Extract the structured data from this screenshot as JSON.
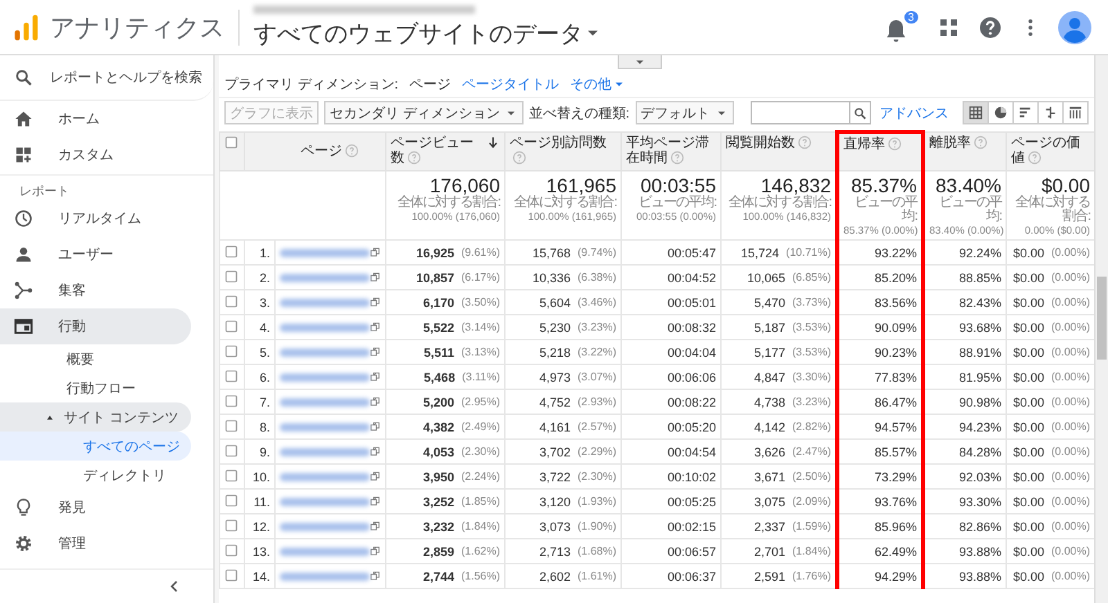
{
  "header": {
    "app_title": "アナリティクス",
    "property_title": "すべてのウェブサイトのデータ",
    "notification_count": "3"
  },
  "sidebar": {
    "search_label": "レポートとヘルプを検索",
    "items": [
      {
        "kind": "link",
        "label": "ホーム",
        "selected": false
      },
      {
        "kind": "link",
        "label": "カスタム",
        "selected": false
      },
      {
        "kind": "section",
        "label": "レポート"
      },
      {
        "kind": "link",
        "label": "リアルタイム",
        "selected": false
      },
      {
        "kind": "link",
        "label": "ユーザー",
        "selected": false
      },
      {
        "kind": "link",
        "label": "集客",
        "selected": false
      },
      {
        "kind": "group",
        "label": "行動",
        "expanded": true,
        "children": [
          {
            "label": "概要",
            "selected": false
          },
          {
            "label": "行動フロー",
            "selected": false
          },
          {
            "label": "サイト コンテンツ",
            "expanded": true,
            "children": [
              {
                "label": "すべてのページ",
                "selected": true
              },
              {
                "label": "ディレクトリ",
                "selected": false
              }
            ]
          }
        ]
      },
      {
        "kind": "link",
        "label": "発見",
        "selected": false
      },
      {
        "kind": "link",
        "label": "管理",
        "selected": false
      }
    ]
  },
  "report": {
    "primary_dimension": {
      "label": "プライマリ ディメンション:",
      "options": [
        {
          "label": "ページ",
          "selected": true,
          "dropdown": false
        },
        {
          "label": "ページタイトル",
          "selected": false,
          "dropdown": false
        },
        {
          "label": "その他",
          "selected": false,
          "dropdown": true
        }
      ]
    },
    "toolbar": {
      "chart_button": {
        "label": "グラフに表示",
        "disabled": true
      },
      "secondary_dimension": "セカンダリ ディメンション",
      "sort_label": "並べ替えの種類:",
      "sort_value": "デフォルト",
      "advanced_link": "アドバンス",
      "views": [
        {
          "selected": true
        },
        {
          "selected": false
        },
        {
          "selected": false
        },
        {
          "selected": false
        },
        {
          "selected": false
        }
      ]
    },
    "table": {
      "columns": [
        {
          "label": "ページ",
          "sorted": false,
          "highlighted": false
        },
        {
          "label": "ページビュー数",
          "sorted": true,
          "highlighted": false
        },
        {
          "label": "ページ別訪問数",
          "sorted": false,
          "highlighted": false
        },
        {
          "label": "平均ページ滞在時間",
          "sorted": false,
          "highlighted": false
        },
        {
          "label": "閲覧開始数",
          "sorted": false,
          "highlighted": false
        },
        {
          "label": "直帰率",
          "sorted": false,
          "highlighted": true
        },
        {
          "label": "離脱率",
          "sorted": false,
          "highlighted": false
        },
        {
          "label": "ページの価値",
          "sorted": false,
          "highlighted": false
        }
      ],
      "totals": [
        {
          "value": "176,060",
          "label": "全体に対する割合:",
          "detail": "100.00% (176,060)"
        },
        {
          "value": "161,965",
          "label": "全体に対する割合:",
          "detail": "100.00% (161,965)"
        },
        {
          "value": "00:03:55",
          "label": "ビューの平均:",
          "detail": "00:03:55 (0.00%)"
        },
        {
          "value": "146,832",
          "label": "全体に対する割合:",
          "detail": "100.00% (146,832)"
        },
        {
          "value": "85.37%",
          "label": "ビューの平均:",
          "detail": "85.37% (0.00%)"
        },
        {
          "value": "83.40%",
          "label": "ビューの平均:",
          "detail": "83.40% (0.00%)"
        },
        {
          "value": "$0.00",
          "label": "全体に対する割合:",
          "detail": "0.00% ($0.00)"
        }
      ],
      "rows": [
        {
          "selected": false,
          "number": "1.",
          "cells": [
            [
              ""
            ],
            [
              "16,925",
              "(9.61%)"
            ],
            [
              "15,768",
              "(9.74%)"
            ],
            [
              "00:05:47"
            ],
            [
              "15,724",
              "(10.71%)"
            ],
            [
              "93.22%"
            ],
            [
              "92.24%"
            ],
            [
              "$0.00",
              "(0.00%)"
            ]
          ]
        },
        {
          "selected": false,
          "number": "2.",
          "cells": [
            [
              ""
            ],
            [
              "10,857",
              "(6.17%)"
            ],
            [
              "10,336",
              "(6.38%)"
            ],
            [
              "00:04:52"
            ],
            [
              "10,065",
              "(6.85%)"
            ],
            [
              "85.20%"
            ],
            [
              "88.85%"
            ],
            [
              "$0.00",
              "(0.00%)"
            ]
          ]
        },
        {
          "selected": false,
          "number": "3.",
          "cells": [
            [
              ""
            ],
            [
              "6,170",
              "(3.50%)"
            ],
            [
              "5,604",
              "(3.46%)"
            ],
            [
              "00:05:01"
            ],
            [
              "5,470",
              "(3.73%)"
            ],
            [
              "83.56%"
            ],
            [
              "82.43%"
            ],
            [
              "$0.00",
              "(0.00%)"
            ]
          ]
        },
        {
          "selected": false,
          "number": "4.",
          "cells": [
            [
              ""
            ],
            [
              "5,522",
              "(3.14%)"
            ],
            [
              "5,230",
              "(3.23%)"
            ],
            [
              "00:08:32"
            ],
            [
              "5,187",
              "(3.53%)"
            ],
            [
              "90.09%"
            ],
            [
              "93.68%"
            ],
            [
              "$0.00",
              "(0.00%)"
            ]
          ]
        },
        {
          "selected": false,
          "number": "5.",
          "cells": [
            [
              ""
            ],
            [
              "5,511",
              "(3.13%)"
            ],
            [
              "5,218",
              "(3.22%)"
            ],
            [
              "00:04:04"
            ],
            [
              "5,177",
              "(3.53%)"
            ],
            [
              "90.23%"
            ],
            [
              "88.91%"
            ],
            [
              "$0.00",
              "(0.00%)"
            ]
          ]
        },
        {
          "selected": false,
          "number": "6.",
          "cells": [
            [
              ""
            ],
            [
              "5,468",
              "(3.11%)"
            ],
            [
              "4,973",
              "(3.07%)"
            ],
            [
              "00:06:06"
            ],
            [
              "4,847",
              "(3.30%)"
            ],
            [
              "77.83%"
            ],
            [
              "81.95%"
            ],
            [
              "$0.00",
              "(0.00%)"
            ]
          ]
        },
        {
          "selected": false,
          "number": "7.",
          "cells": [
            [
              ""
            ],
            [
              "5,200",
              "(2.95%)"
            ],
            [
              "4,752",
              "(2.93%)"
            ],
            [
              "00:08:22"
            ],
            [
              "4,738",
              "(3.23%)"
            ],
            [
              "86.47%"
            ],
            [
              "90.98%"
            ],
            [
              "$0.00",
              "(0.00%)"
            ]
          ]
        },
        {
          "selected": false,
          "number": "8.",
          "cells": [
            [
              ""
            ],
            [
              "4,382",
              "(2.49%)"
            ],
            [
              "4,161",
              "(2.57%)"
            ],
            [
              "00:05:20"
            ],
            [
              "4,142",
              "(2.82%)"
            ],
            [
              "94.57%"
            ],
            [
              "94.23%"
            ],
            [
              "$0.00",
              "(0.00%)"
            ]
          ]
        },
        {
          "selected": false,
          "number": "9.",
          "cells": [
            [
              ""
            ],
            [
              "4,053",
              "(2.30%)"
            ],
            [
              "3,702",
              "(2.29%)"
            ],
            [
              "00:04:54"
            ],
            [
              "3,626",
              "(2.47%)"
            ],
            [
              "85.57%"
            ],
            [
              "84.28%"
            ],
            [
              "$0.00",
              "(0.00%)"
            ]
          ]
        },
        {
          "selected": false,
          "number": "10.",
          "cells": [
            [
              ""
            ],
            [
              "3,950",
              "(2.24%)"
            ],
            [
              "3,722",
              "(2.30%)"
            ],
            [
              "00:10:02"
            ],
            [
              "3,671",
              "(2.50%)"
            ],
            [
              "73.29%"
            ],
            [
              "92.03%"
            ],
            [
              "$0.00",
              "(0.00%)"
            ]
          ]
        },
        {
          "selected": false,
          "number": "11.",
          "cells": [
            [
              ""
            ],
            [
              "3,252",
              "(1.85%)"
            ],
            [
              "3,120",
              "(1.93%)"
            ],
            [
              "00:05:25"
            ],
            [
              "3,075",
              "(2.09%)"
            ],
            [
              "93.76%"
            ],
            [
              "93.30%"
            ],
            [
              "$0.00",
              "(0.00%)"
            ]
          ]
        },
        {
          "selected": false,
          "number": "12.",
          "cells": [
            [
              ""
            ],
            [
              "3,232",
              "(1.84%)"
            ],
            [
              "3,073",
              "(1.90%)"
            ],
            [
              "00:02:15"
            ],
            [
              "2,337",
              "(1.59%)"
            ],
            [
              "85.96%"
            ],
            [
              "82.86%"
            ],
            [
              "$0.00",
              "(0.00%)"
            ]
          ]
        },
        {
          "selected": false,
          "number": "13.",
          "cells": [
            [
              ""
            ],
            [
              "2,859",
              "(1.62%)"
            ],
            [
              "2,713",
              "(1.68%)"
            ],
            [
              "00:06:57"
            ],
            [
              "2,701",
              "(1.84%)"
            ],
            [
              "62.49%"
            ],
            [
              "93.88%"
            ],
            [
              "$0.00",
              "(0.00%)"
            ]
          ]
        },
        {
          "selected": false,
          "number": "14.",
          "cells": [
            [
              ""
            ],
            [
              "2,744",
              "(1.56%)"
            ],
            [
              "2,602",
              "(1.61%)"
            ],
            [
              "00:06:37"
            ],
            [
              "2,591",
              "(1.76%)"
            ],
            [
              "94.29%"
            ],
            [
              "93.88%"
            ],
            [
              "$0.00",
              "(0.00%)"
            ]
          ]
        }
      ]
    }
  }
}
